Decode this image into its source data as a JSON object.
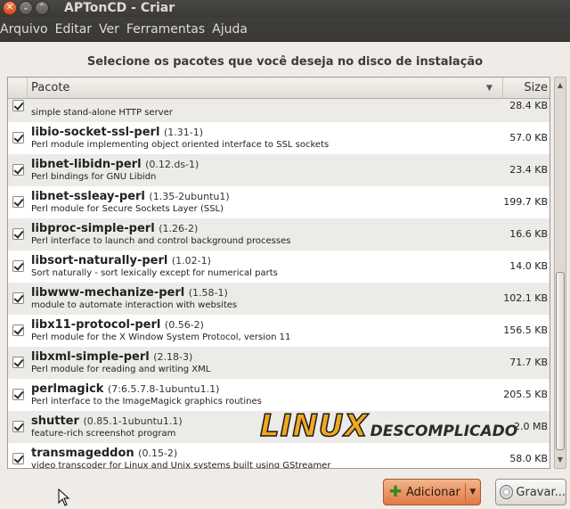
{
  "window": {
    "title": "APTonCD - Criar"
  },
  "menu": [
    "Arquivo",
    "Editar",
    "Ver",
    "Ferramentas",
    "Ajuda"
  ],
  "heading": "Selecione os pacotes que você deseja no disco de instalação",
  "table": {
    "col_name": "Pacote",
    "col_size": "Size",
    "rows": [
      {
        "name": "",
        "version": "",
        "desc": "simple stand-alone HTTP server",
        "size": "28.4 KB",
        "checked": true
      },
      {
        "name": "libio-socket-ssl-perl",
        "version": "(1.31-1)",
        "desc": "Perl module implementing object oriented interface to SSL sockets",
        "size": "57.0 KB",
        "checked": true
      },
      {
        "name": "libnet-libidn-perl",
        "version": "(0.12.ds-1)",
        "desc": "Perl bindings for GNU Libidn",
        "size": "23.4 KB",
        "checked": true
      },
      {
        "name": "libnet-ssleay-perl",
        "version": "(1.35-2ubuntu1)",
        "desc": "Perl module for Secure Sockets Layer (SSL)",
        "size": "199.7 KB",
        "checked": true
      },
      {
        "name": "libproc-simple-perl",
        "version": "(1.26-2)",
        "desc": "Perl interface to launch and control background processes",
        "size": "16.6 KB",
        "checked": true
      },
      {
        "name": "libsort-naturally-perl",
        "version": "(1.02-1)",
        "desc": "Sort naturally - sort lexically except for numerical parts",
        "size": "14.0 KB",
        "checked": true
      },
      {
        "name": "libwww-mechanize-perl",
        "version": "(1.58-1)",
        "desc": "module to automate interaction with websites",
        "size": "102.1 KB",
        "checked": true
      },
      {
        "name": "libx11-protocol-perl",
        "version": "(0.56-2)",
        "desc": "Perl module for the X Window System Protocol, version 11",
        "size": "156.5 KB",
        "checked": true
      },
      {
        "name": "libxml-simple-perl",
        "version": "(2.18-3)",
        "desc": "Perl module for reading and writing XML",
        "size": "71.7 KB",
        "checked": true
      },
      {
        "name": "perlmagick",
        "version": "(7:6.5.7.8-1ubuntu1.1)",
        "desc": "Perl interface to the ImageMagick graphics routines",
        "size": "205.5 KB",
        "checked": true
      },
      {
        "name": "shutter",
        "version": "(0.85.1-1ubuntu1.1)",
        "desc": "feature-rich screenshot program",
        "size": "2.0 MB",
        "checked": true
      },
      {
        "name": "transmageddon",
        "version": "(0.15-2)",
        "desc": "video transcoder for Linux and Unix systems built using GStreamer",
        "size": "58.0 KB",
        "checked": true
      }
    ]
  },
  "watermark": {
    "big": "LINUX",
    "small": "DESCOMPLICADO"
  },
  "buttons": {
    "add": "Adicionar",
    "save": "Gravar..."
  }
}
